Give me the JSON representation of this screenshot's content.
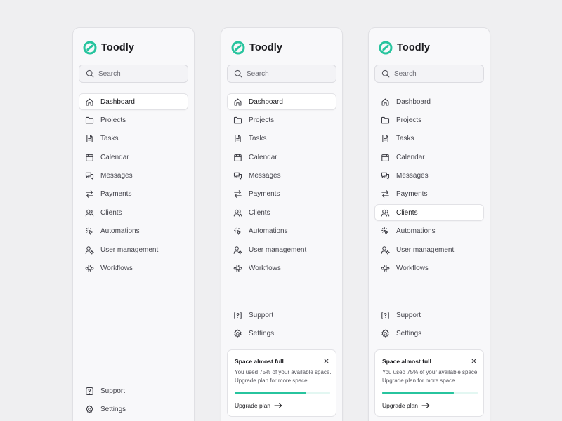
{
  "brand": {
    "name": "Toodly",
    "accent": "#27c49e"
  },
  "search": {
    "placeholder": "Search"
  },
  "nav": [
    {
      "label": "Dashboard",
      "icon": "home-icon"
    },
    {
      "label": "Projects",
      "icon": "folder-icon"
    },
    {
      "label": "Tasks",
      "icon": "document-icon"
    },
    {
      "label": "Calendar",
      "icon": "calendar-icon"
    },
    {
      "label": "Messages",
      "icon": "chat-icon"
    },
    {
      "label": "Payments",
      "icon": "transfer-arrows-icon"
    },
    {
      "label": "Clients",
      "icon": "users-icon"
    },
    {
      "label": "Automations",
      "icon": "cursor-click-icon"
    },
    {
      "label": "User management",
      "icon": "user-settings-icon"
    },
    {
      "label": "Workflows",
      "icon": "workflow-icon"
    }
  ],
  "bottom_nav": [
    {
      "label": "Support",
      "icon": "help-icon"
    },
    {
      "label": "Settings",
      "icon": "gear-icon"
    }
  ],
  "variants": [
    {
      "active": "Dashboard",
      "show_card": false
    },
    {
      "active": "Dashboard",
      "show_card": true
    },
    {
      "active": "Clients",
      "show_card": true
    }
  ],
  "space_card": {
    "title": "Space almost full",
    "text": "You used 75% of your available space. Upgrade plan for more space.",
    "progress": 0.75,
    "cta": "Upgrade plan"
  },
  "colors": {
    "background": "#efeff1",
    "panel": "#f8f8fa",
    "progress_track": "#e3f7f2"
  }
}
